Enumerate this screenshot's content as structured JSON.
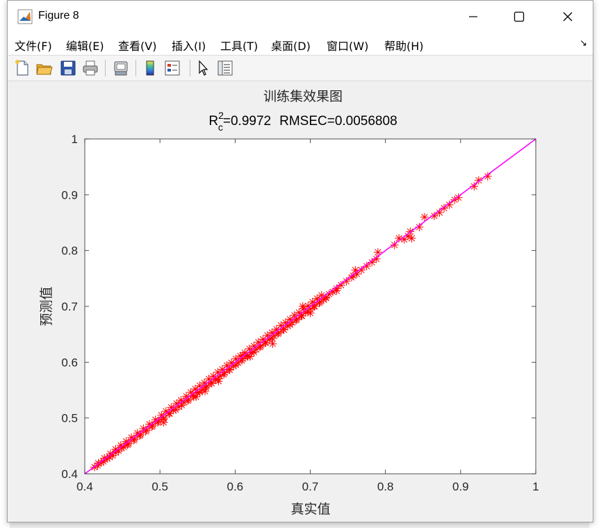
{
  "window": {
    "title": "Figure 8"
  },
  "menu": [
    "文件(F)",
    "编辑(E)",
    "查看(V)",
    "插入(I)",
    "工具(T)",
    "桌面(D)",
    "窗口(W)",
    "帮助(H)"
  ],
  "toolbar": [
    "new-figure",
    "open-file",
    "save",
    "print",
    "print-preview",
    "insert-colorbar",
    "insert-legend",
    "edit-plot",
    "property-inspector"
  ],
  "colors": {
    "marker": "#ff0000",
    "fit_line": "#ff00ff"
  },
  "chart_data": {
    "type": "scatter",
    "title": "训练集效果图",
    "subtitle": {
      "r2_base": "R",
      "r2_sup": "2",
      "r2_sub": "c",
      "r2_value": "=0.9972",
      "rmse": "RMSEC=0.0056808"
    },
    "xlabel": "真实值",
    "ylabel": "预测值",
    "xlim": [
      0.4,
      1
    ],
    "ylim": [
      0.4,
      1
    ],
    "xticks": [
      "0.4",
      "0.5",
      "0.6",
      "0.7",
      "0.8",
      "0.9",
      "1"
    ],
    "yticks": [
      "0.4",
      "0.5",
      "0.6",
      "0.7",
      "0.8",
      "0.9",
      "1"
    ],
    "grid": false,
    "marker": "asterisk",
    "series": [
      {
        "x": [
          0.413,
          0.418,
          0.422,
          0.426,
          0.43,
          0.434,
          0.437,
          0.441,
          0.445,
          0.448,
          0.452,
          0.455,
          0.458,
          0.462,
          0.466,
          0.47,
          0.474,
          0.478,
          0.482,
          0.486,
          0.49,
          0.494,
          0.498,
          0.502,
          0.505,
          0.508,
          0.512,
          0.515,
          0.518,
          0.522,
          0.525,
          0.528,
          0.532,
          0.535,
          0.538,
          0.541,
          0.544,
          0.547,
          0.55,
          0.553,
          0.556,
          0.559,
          0.562,
          0.565,
          0.568,
          0.571,
          0.574,
          0.577,
          0.58,
          0.583,
          0.586,
          0.589,
          0.592,
          0.595,
          0.598,
          0.601,
          0.604,
          0.607,
          0.61,
          0.613,
          0.616,
          0.619,
          0.622,
          0.625,
          0.628,
          0.631,
          0.634,
          0.637,
          0.64,
          0.643,
          0.646,
          0.649,
          0.652,
          0.655,
          0.658,
          0.661,
          0.664,
          0.667,
          0.67,
          0.673,
          0.676,
          0.679,
          0.682,
          0.685,
          0.688,
          0.691,
          0.694,
          0.697,
          0.7,
          0.703,
          0.706,
          0.709,
          0.712,
          0.715,
          0.718,
          0.721,
          0.725,
          0.73,
          0.735,
          0.741,
          0.748,
          0.755,
          0.76,
          0.762,
          0.768,
          0.775,
          0.782,
          0.788,
          0.79,
          0.812,
          0.818,
          0.825,
          0.83,
          0.833,
          0.845,
          0.852,
          0.865,
          0.872,
          0.878,
          0.885,
          0.892,
          0.897,
          0.918,
          0.924,
          0.936,
          0.417,
          0.425,
          0.433,
          0.441,
          0.449,
          0.457,
          0.465,
          0.473,
          0.481,
          0.489,
          0.497,
          0.505,
          0.513,
          0.521,
          0.529,
          0.537,
          0.545,
          0.553,
          0.561,
          0.569,
          0.577,
          0.585,
          0.593,
          0.601,
          0.609,
          0.617,
          0.625,
          0.633,
          0.641,
          0.649,
          0.657,
          0.665,
          0.673,
          0.681,
          0.689,
          0.697,
          0.705,
          0.713,
          0.721,
          0.505,
          0.548,
          0.578,
          0.62,
          0.65,
          0.69,
          0.735,
          0.757,
          0.835,
          0.7,
          0.56,
          0.61
        ],
        "y": [
          0.412,
          0.419,
          0.42,
          0.428,
          0.427,
          0.436,
          0.433,
          0.444,
          0.441,
          0.451,
          0.448,
          0.458,
          0.454,
          0.465,
          0.462,
          0.473,
          0.47,
          0.481,
          0.478,
          0.489,
          0.486,
          0.497,
          0.494,
          0.505,
          0.5,
          0.512,
          0.508,
          0.519,
          0.514,
          0.526,
          0.52,
          0.532,
          0.528,
          0.539,
          0.533,
          0.546,
          0.54,
          0.552,
          0.545,
          0.558,
          0.551,
          0.563,
          0.557,
          0.57,
          0.563,
          0.575,
          0.569,
          0.582,
          0.575,
          0.587,
          0.581,
          0.594,
          0.587,
          0.599,
          0.593,
          0.606,
          0.599,
          0.611,
          0.606,
          0.617,
          0.611,
          0.624,
          0.617,
          0.629,
          0.623,
          0.636,
          0.629,
          0.641,
          0.635,
          0.648,
          0.641,
          0.653,
          0.647,
          0.659,
          0.653,
          0.666,
          0.659,
          0.671,
          0.665,
          0.677,
          0.671,
          0.684,
          0.677,
          0.689,
          0.683,
          0.696,
          0.689,
          0.701,
          0.695,
          0.708,
          0.7,
          0.714,
          0.706,
          0.72,
          0.712,
          0.716,
          0.722,
          0.726,
          0.732,
          0.738,
          0.745,
          0.752,
          0.765,
          0.758,
          0.765,
          0.772,
          0.779,
          0.785,
          0.797,
          0.81,
          0.822,
          0.82,
          0.826,
          0.834,
          0.842,
          0.86,
          0.862,
          0.868,
          0.876,
          0.882,
          0.891,
          0.895,
          0.915,
          0.926,
          0.933,
          0.415,
          0.422,
          0.43,
          0.438,
          0.446,
          0.452,
          0.46,
          0.468,
          0.476,
          0.484,
          0.492,
          0.498,
          0.508,
          0.515,
          0.523,
          0.531,
          0.538,
          0.546,
          0.555,
          0.562,
          0.57,
          0.578,
          0.586,
          0.595,
          0.603,
          0.61,
          0.618,
          0.627,
          0.635,
          0.643,
          0.651,
          0.658,
          0.667,
          0.675,
          0.683,
          0.691,
          0.7,
          0.708,
          0.715,
          0.492,
          0.538,
          0.566,
          0.61,
          0.633,
          0.7,
          0.728,
          0.755,
          0.822,
          0.688,
          0.548,
          0.612
        ]
      }
    ],
    "fit_line": {
      "x": [
        0.4,
        1
      ],
      "y": [
        0.4,
        1
      ]
    }
  }
}
